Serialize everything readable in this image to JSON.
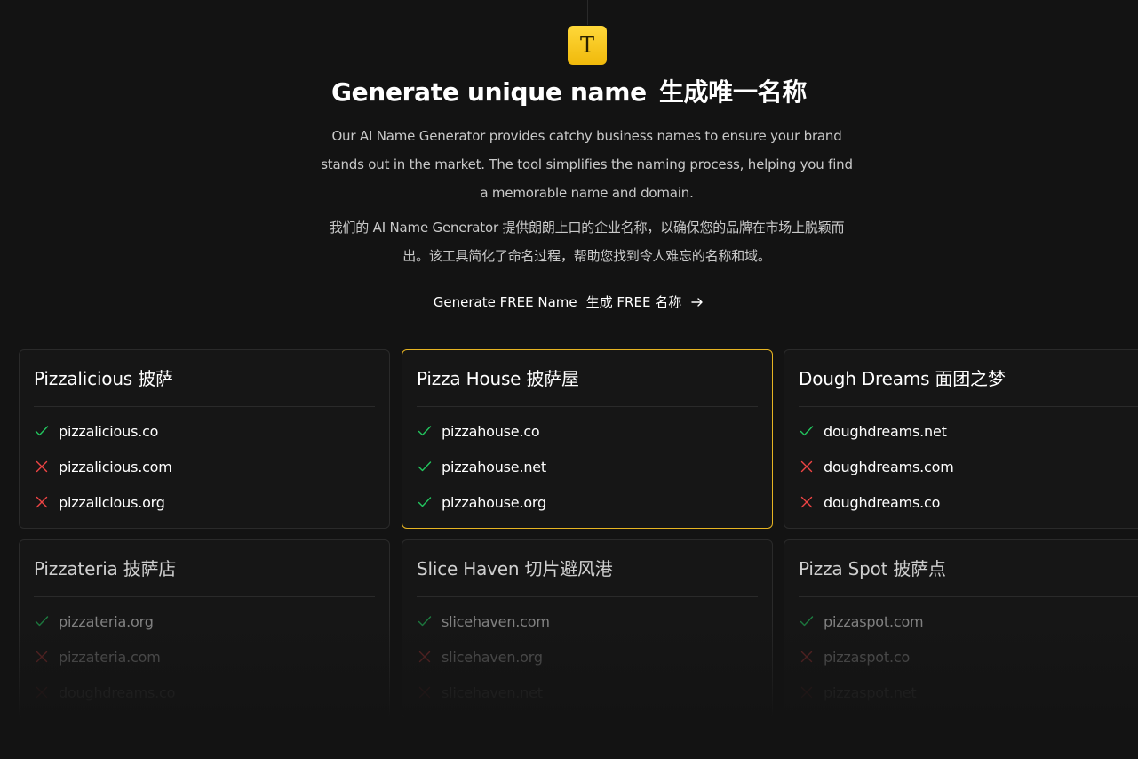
{
  "logo": {
    "glyph": "T",
    "icon": "text-t-icon",
    "color": "#f5c518"
  },
  "hero": {
    "title_en": "Generate unique name",
    "title_cn": "生成唯一名称",
    "desc_en": "Our AI Name Generator provides catchy business names to ensure your brand stands out in the market. The tool simplifies the naming process, helping you find a memorable name and domain.",
    "desc_cn": "我们的 AI Name Generator 提供朗朗上口的企业名称，以确保您的品牌在市场上脱颖而出。该工具简化了命名过程，帮助您找到令人难忘的名称和域。",
    "cta_en": "Generate FREE Name",
    "cta_cn": "生成 FREE 名称"
  },
  "colors": {
    "available": "#22c55e",
    "unavailable": "#ef4444",
    "selected_border": "#e6b422"
  },
  "cards": [
    {
      "title": "Pizzalicious 披萨",
      "domains": [
        {
          "name": "pizzalicious.co",
          "status": "available"
        },
        {
          "name": "pizzalicious.com",
          "status": "unavailable"
        },
        {
          "name": "pizzalicious.org",
          "status": "unavailable"
        }
      ]
    },
    {
      "title": "Pizza House 披萨屋",
      "domains": [
        {
          "name": "pizzahouse.co",
          "status": "available"
        },
        {
          "name": "pizzahouse.net",
          "status": "available"
        },
        {
          "name": "pizzahouse.org",
          "status": "available"
        }
      ]
    },
    {
      "title": "Dough Dreams 面团之梦",
      "domains": [
        {
          "name": "doughdreams.net",
          "status": "available"
        },
        {
          "name": "doughdreams.com",
          "status": "unavailable"
        },
        {
          "name": "doughdreams.co",
          "status": "unavailable"
        }
      ]
    },
    {
      "title": "Pizzateria 披萨店",
      "domains": [
        {
          "name": "pizzateria.org",
          "status": "available"
        },
        {
          "name": "pizzateria.com",
          "status": "unavailable"
        },
        {
          "name": "doughdreams.co",
          "status": "unavailable"
        }
      ]
    },
    {
      "title": "Slice Haven 切片避风港",
      "domains": [
        {
          "name": "slicehaven.com",
          "status": "available"
        },
        {
          "name": "slicehaven.org",
          "status": "unavailable"
        },
        {
          "name": "slicehaven.net",
          "status": "unavailable"
        }
      ]
    },
    {
      "title": "Pizza Spot 披萨点",
      "domains": [
        {
          "name": "pizzaspot.com",
          "status": "available"
        },
        {
          "name": "pizzaspot.co",
          "status": "unavailable"
        },
        {
          "name": "pizzaspot.net",
          "status": "unavailable"
        }
      ]
    }
  ]
}
